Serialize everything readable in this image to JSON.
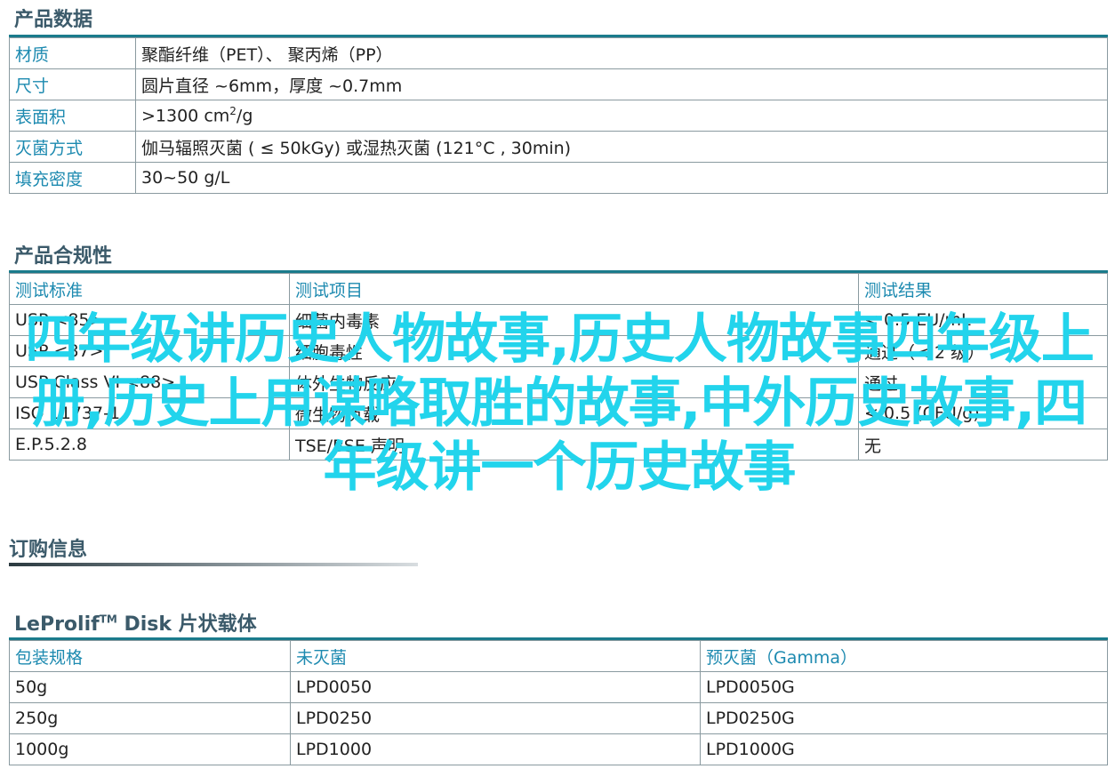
{
  "sections": {
    "product_data": "产品数据",
    "compliance": "产品合规性",
    "order_info": "订购信息",
    "disk_title_prefix": "LeProlif",
    "disk_title_tm": "TM",
    "disk_title_suffix": " Disk 片状载体"
  },
  "product_data_rows": [
    {
      "label": "材质",
      "value": "聚酯纤维（PET）、 聚丙烯（PP）"
    },
    {
      "label": "尺寸",
      "value": "圆片直径 ~6mm，厚度 ~0.7mm"
    },
    {
      "label": "表面积",
      "value_prefix": ">1300 cm",
      "value_sup": "2",
      "value_suffix": "/g"
    },
    {
      "label": "灭菌方式",
      "value": "伽马辐照灭菌 ( ≤ 50kGy) 或湿热灭菌 (121°C , 30min)"
    },
    {
      "label": "填充密度",
      "value": "30~50 g/L"
    }
  ],
  "compliance_table": {
    "headers": [
      "测试标准",
      "测试项目",
      "测试结果"
    ],
    "rows": [
      [
        "USP <85>",
        "细菌内毒素",
        "< 0.5 EU/mL"
      ],
      [
        "USP <87>",
        "细胞毒性",
        "通过（< 2 级）"
      ],
      [
        "USP Class VI <88>",
        "体外生物反应",
        "通过"
      ],
      [
        "ISO 11737-1",
        "微生物负载",
        "< 0.5 (CFU/g)"
      ],
      [
        "E.P.5.2.8",
        "TSE/BSE 声明",
        "无"
      ]
    ]
  },
  "order_table": {
    "headers": [
      "包装规格",
      "未灭菌",
      "预灭菌（Gamma）"
    ],
    "rows": [
      [
        "50g",
        "LPD0050",
        "LPD0050G"
      ],
      [
        "250g",
        "LPD0250",
        "LPD0250G"
      ],
      [
        "1000g",
        "LPD1000",
        "LPD1000G"
      ]
    ]
  },
  "watermark": "四年级讲历史人物故事,历史人物故事四年级上册,历史上用谋略取胜的故事,中外历史故事,四年级讲一个历史故事",
  "colors": {
    "header_bar": "#1a7b8c",
    "label_text": "#1d8ab0",
    "watermark": "#22d4ec"
  }
}
